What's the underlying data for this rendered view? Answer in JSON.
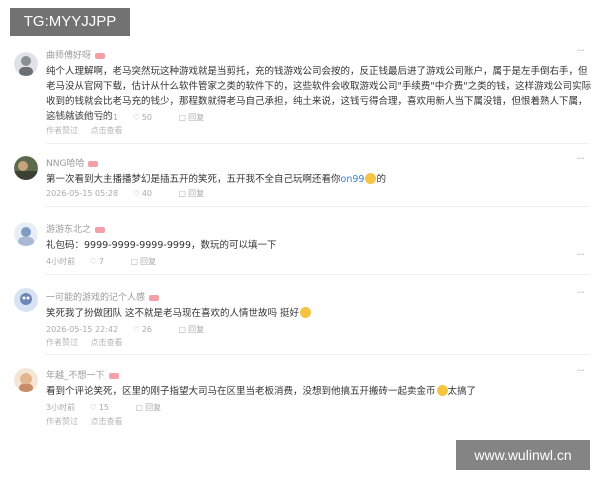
{
  "watermark_top": "TG:MYYJJPP",
  "watermark_bottom": "www.wulinwl.cn",
  "comments": [
    {
      "username": "曲师傅好呀",
      "text": "纯个人理解啊，老马突然玩这种游戏就是当剪托，充的钱游戏公司会按的，反正钱最后进了游戏公司账户，属于是左手倒右手，但老马没从官网下载，估计从什么软件管家之类的软件下的，这些软件会收取游戏公司\"手续费\"中介费\"之类的钱，这样游戏公司实际收到的钱就会比老马充的钱少，那程数就得老马自己承担，纯土来说，这钱亏得合理，喜欢用新人当下属没错，但恨着熟人下属，这钱就该他亏的",
      "time": "2026-05-15 18:51",
      "likes": "50",
      "reply": "回复",
      "sub1": "作者赞过",
      "sub2": "点击查看"
    },
    {
      "username": "NNG哈哈",
      "text_before": "第一次看到大主播播梦幻是插五开的笑死，五开我不全自己玩啊还看你",
      "mention": "on99",
      "text_after": "的",
      "time": "2026-05-15 05:28",
      "likes": "40",
      "reply": "回复"
    },
    {
      "username": "游游东北之",
      "text": "礼包码：9999-9999-9999-9999，数玩的可以填一下",
      "time": "4小时前",
      "likes": "7",
      "reply": "回复"
    },
    {
      "username": "一可能的游戏的记个人感",
      "text": "笑死我了扮做团队 这不就是老马现在喜欢的人情世故吗 挺好",
      "time": "2026-05-15 22:42",
      "likes": "26",
      "reply": "回复",
      "sub1": "作者赞过",
      "sub2": "点击查看"
    },
    {
      "username": "年越_不想一下",
      "text": "看到个评论笑死，区里的刚子指望大司马在区里当老板消费，没想到他搞五开搬砖一起卖金币",
      "text_tail": "太搞了",
      "time": "3小时前",
      "likes": "15",
      "reply": "回复",
      "sub1": "作者赞过",
      "sub2": "点击查看"
    }
  ],
  "more_label": "···",
  "heart_icon": "heart-icon",
  "comment_icon": "comment-icon"
}
